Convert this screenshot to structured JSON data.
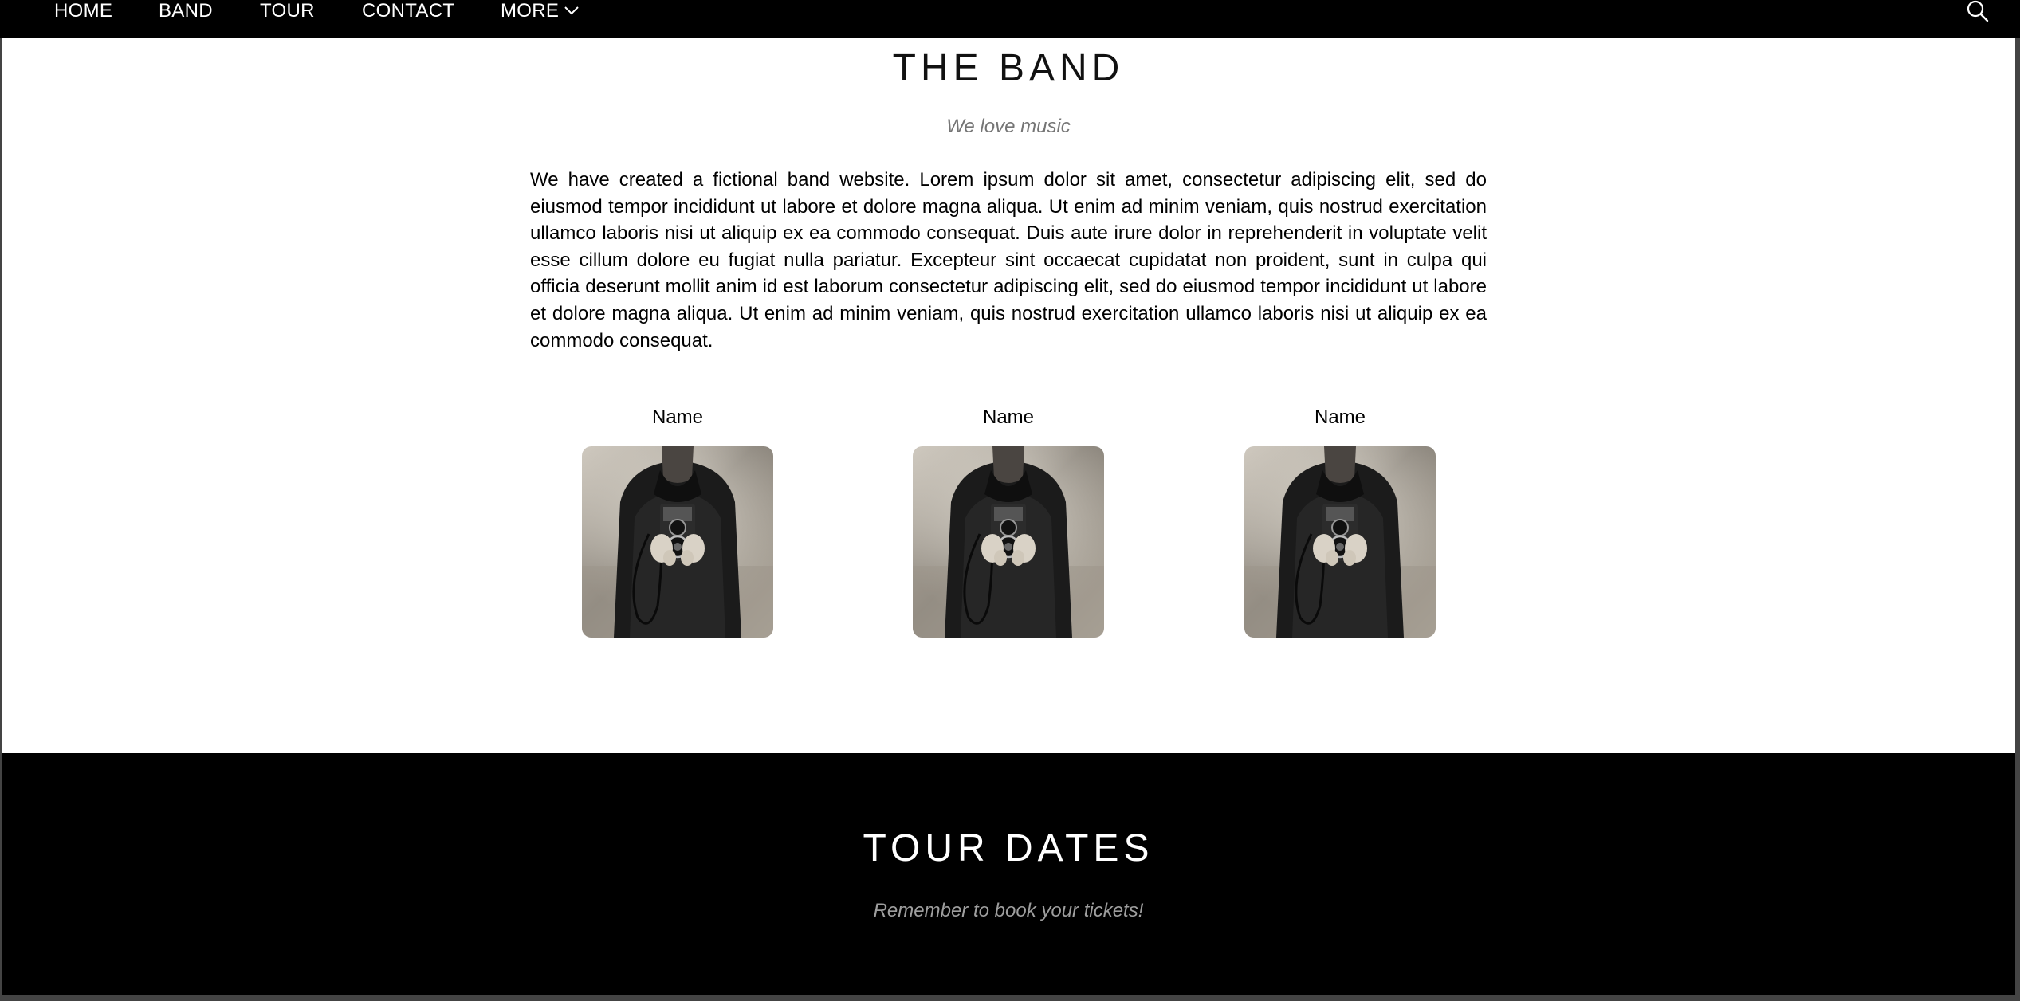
{
  "nav": {
    "items": [
      "HOME",
      "BAND",
      "TOUR",
      "CONTACT"
    ],
    "more_label": "MORE",
    "more_icon": "chevron-down-icon",
    "search_icon": "search-icon"
  },
  "band": {
    "title": "THE BAND",
    "subtitle": "We love music",
    "description": "We have created a fictional band website. Lorem ipsum dolor sit amet, consectetur adipiscing elit, sed do eiusmod tempor incididunt ut labore et dolore magna aliqua. Ut enim ad minim veniam, quis nostrud exercitation ullamco laboris nisi ut aliquip ex ea commodo consequat. Duis aute irure dolor in reprehenderit in voluptate velit esse cillum dolore eu fugiat nulla pariatur. Excepteur sint occaecat cupidatat non proident, sunt in culpa qui officia deserunt mollit anim id est laborum consectetur adipiscing elit, sed do eiusmod tempor incididunt ut labore et dolore magna aliqua. Ut enim ad minim veniam, quis nostrud exercitation ullamco laboris nisi ut aliquip ex ea commodo consequat.",
    "members": [
      {
        "name": "Name"
      },
      {
        "name": "Name"
      },
      {
        "name": "Name"
      }
    ]
  },
  "tour": {
    "title": "TOUR DATES",
    "subtitle": "Remember to book your tickets!"
  },
  "colors": {
    "nav_bg": "#000000",
    "band_bg": "#ffffff",
    "tour_bg": "#000000",
    "subtitle_gray": "#757575"
  }
}
